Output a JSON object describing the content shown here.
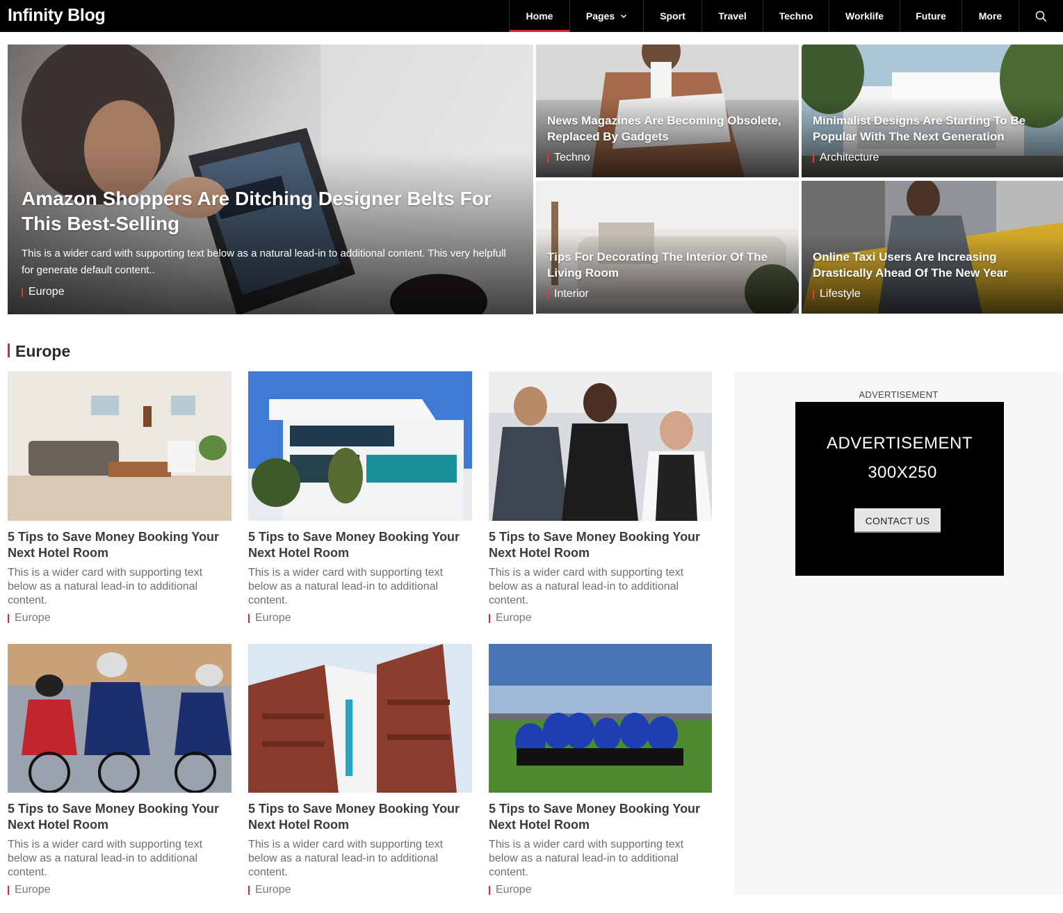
{
  "site": {
    "brand": "Infinity Blog",
    "accent": "#d32f2f"
  },
  "nav": {
    "items": [
      {
        "label": "Home",
        "active": true
      },
      {
        "label": "Pages",
        "dropdown": true
      },
      {
        "label": "Sport"
      },
      {
        "label": "Travel"
      },
      {
        "label": "Techno"
      },
      {
        "label": "Worklife"
      },
      {
        "label": "Future"
      },
      {
        "label": "More"
      }
    ],
    "search_icon": "search-icon"
  },
  "hero": {
    "main": {
      "title": "Amazon Shoppers Are Ditching Designer Belts For This Best-Selling",
      "desc": "This is a wider card with supporting text below as a natural lead-in to additional content. This very helpfull for generate default content..",
      "category": "Europe"
    },
    "tiles": [
      {
        "title": "News Magazines Are Becoming Obsolete, Replaced By Gadgets",
        "category": "Techno"
      },
      {
        "title": "Minimalist Designs Are Starting To Be Popular With The Next Generation",
        "category": "Architecture"
      },
      {
        "title": "Tips For Decorating The Interior Of The Living Room",
        "category": "Interior"
      },
      {
        "title": "Online Taxi Users Are Increasing Drastically Ahead Of The New Year",
        "category": "Lifestyle"
      }
    ]
  },
  "section": {
    "title": "Europe",
    "cards": [
      {
        "title": "5 Tips to Save Money Booking Your Next Hotel Room",
        "desc": "This is a wider card with supporting text below as a natural lead-in to additional content.",
        "category": "Europe"
      },
      {
        "title": "5 Tips to Save Money Booking Your Next Hotel Room",
        "desc": "This is a wider card with supporting text below as a natural lead-in to additional content.",
        "category": "Europe"
      },
      {
        "title": "5 Tips to Save Money Booking Your Next Hotel Room",
        "desc": "This is a wider card with supporting text below as a natural lead-in to additional content.",
        "category": "Europe"
      },
      {
        "title": "5 Tips to Save Money Booking Your Next Hotel Room",
        "desc": "This is a wider card with supporting text below as a natural lead-in to additional content.",
        "category": "Europe"
      },
      {
        "title": "5 Tips to Save Money Booking Your Next Hotel Room",
        "desc": "This is a wider card with supporting text below as a natural lead-in to additional content.",
        "category": "Europe"
      },
      {
        "title": "5 Tips to Save Money Booking Your Next Hotel Room",
        "desc": "This is a wider card with supporting text below as a natural lead-in to additional content.",
        "category": "Europe"
      }
    ]
  },
  "sidebar": {
    "ad_label": "ADVERTISEMENT",
    "ad_line1": "ADVERTISEMENT",
    "ad_line2": "300X250",
    "ad_button": "CONTACT US"
  }
}
